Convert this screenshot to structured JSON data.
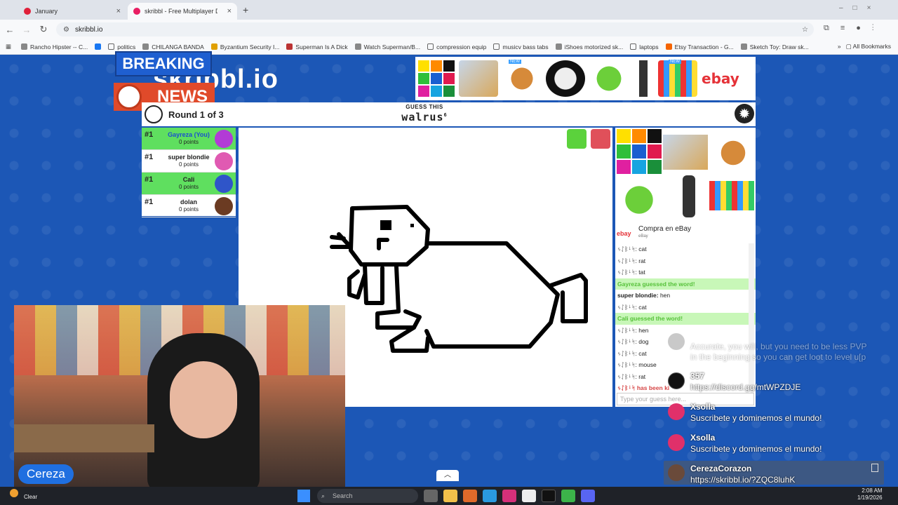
{
  "browser": {
    "tabs": [
      {
        "title": "January",
        "active": false
      },
      {
        "title": "skribbl - Free Multiplayer D",
        "active": true
      }
    ],
    "new_tab": "+",
    "url": "skribbl.io",
    "bookmarks": [
      "Rancho Hipster -- C...",
      "politics",
      "CHILANGA BANDA",
      "Byzantium Security I...",
      "Superman Is A Dick",
      "Watch Superman/B...",
      "compression equip",
      "musicv bass tabs",
      "iShoes motorized sk...",
      "laptops",
      "Etsy Transaction - G...",
      "Sketch Toy: Draw sk..."
    ],
    "all_bookmarks": "All Bookmarks"
  },
  "overlay": {
    "breaking": "BREAKING",
    "news": "NEWS"
  },
  "game": {
    "logo": "skribbl.io",
    "round": "Round 1 of 3",
    "guess_label": "GUESS THIS",
    "word": "walrus",
    "word_length": "6",
    "players": [
      {
        "rank": "#1",
        "name": "Gayreza (You)",
        "points": "0 points",
        "guessed": true,
        "you": true,
        "color": "#b23bd6"
      },
      {
        "rank": "#1",
        "name": "super blondie",
        "points": "0 points",
        "guessed": false,
        "you": false,
        "color": "#e05ab2"
      },
      {
        "rank": "#1",
        "name": "Cali",
        "points": "0 points",
        "guessed": true,
        "you": false,
        "color": "#2f55c9"
      },
      {
        "rank": "#1",
        "name": "dolan",
        "points": "0 points",
        "guessed": false,
        "you": false,
        "color": "#6b3b22"
      }
    ],
    "chat": [
      {
        "user": "ᛃᛇᛒᛍᛋ:",
        "text": "cat",
        "type": "normal"
      },
      {
        "user": "ᛃᛇᛒᛍᛋ:",
        "text": "rat",
        "type": "normal"
      },
      {
        "user": "ᛃᛇᛒᛍᛋ:",
        "text": "tat",
        "type": "normal"
      },
      {
        "user": "",
        "text": "Gayreza guessed the word!",
        "type": "good"
      },
      {
        "user": "super blondie:",
        "text": "hen",
        "type": "bold"
      },
      {
        "user": "ᛃᛇᛒᛍᛋ:",
        "text": "cat",
        "type": "normal"
      },
      {
        "user": "",
        "text": "Cali guessed the word!",
        "type": "good"
      },
      {
        "user": "ᛃᛇᛒᛍᛋ:",
        "text": "hen",
        "type": "normal"
      },
      {
        "user": "ᛃᛇᛒᛍᛋ:",
        "text": "dog",
        "type": "normal"
      },
      {
        "user": "ᛃᛇᛒᛍᛋ:",
        "text": "cat",
        "type": "normal"
      },
      {
        "user": "ᛃᛇᛒᛍᛋ:",
        "text": "mouse",
        "type": "normal"
      },
      {
        "user": "ᛃᛇᛒᛍᛋ:",
        "text": "rat",
        "type": "normal"
      },
      {
        "user": "",
        "text": "ᛃᛇᛒᛍᛋ has been ki",
        "type": "red"
      }
    ],
    "chat_placeholder": "Type your guess here..."
  },
  "ads": {
    "caption": "Compra en eBay",
    "caption_sub": "eBay",
    "ebay": "ebay",
    "new_badge": "NEW"
  },
  "stream": {
    "streamer": "Cereza",
    "chat": [
      {
        "user": "",
        "text": "Accurate, you will, but you need to be less PVP",
        "text2": "in the beginning so you can get loot to level u[p",
        "faded": true
      },
      {
        "user": "357",
        "text": "https://discord.gg/mtWPZDJE"
      },
      {
        "user": "Xsolla",
        "text": "Suscribete y dominemos el mundo!"
      },
      {
        "user": "Xsolla",
        "text": "Suscribete y dominemos el mundo!"
      },
      {
        "user": "CerezaCorazon",
        "text": "https://skribbl.io/?ZQC8luhK"
      }
    ]
  },
  "taskbar": {
    "weather": "Clear",
    "search": "Search",
    "time": "2:08 AM",
    "date": "1/19/2026"
  }
}
